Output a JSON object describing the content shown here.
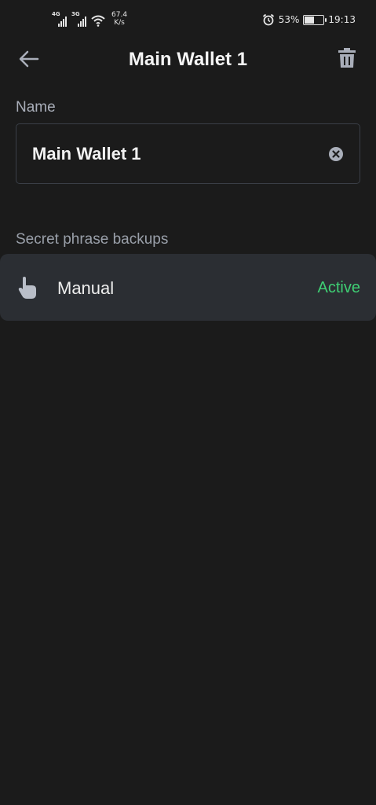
{
  "status_bar": {
    "signal1_tag": "4G",
    "signal2_tag": "3G",
    "net_speed_value": "67.4",
    "net_speed_unit": "K/s",
    "battery_percent": "53%",
    "battery_level": 0.53,
    "time": "19:13",
    "icons": [
      "signal-icon",
      "wifi-icon",
      "alarm-icon",
      "battery-icon"
    ]
  },
  "header": {
    "title": "Main Wallet 1",
    "back_icon": "arrow-left-icon",
    "delete_icon": "trash-icon"
  },
  "name_section": {
    "label": "Name",
    "value": "Main Wallet 1",
    "clear_icon": "clear-circle-icon"
  },
  "backups": {
    "label": "Secret phrase backups",
    "items": [
      {
        "icon": "hand-pointer-icon",
        "label": "Manual",
        "status": "Active",
        "status_color": "#3fcf74"
      }
    ]
  },
  "colors": {
    "background": "#1b1b1b",
    "row_background": "#2b2e33",
    "accent_green": "#3fcf74",
    "muted_text": "#a9aeb9"
  }
}
